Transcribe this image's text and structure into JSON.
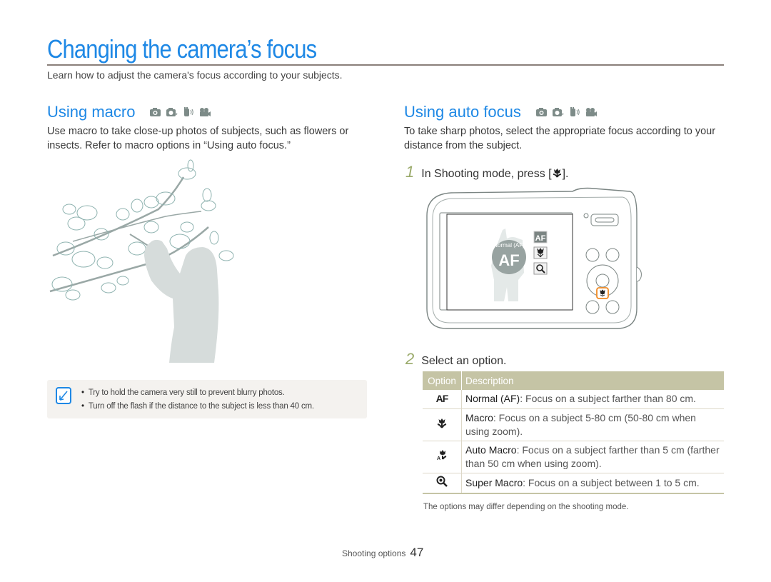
{
  "page": {
    "title": "Changing the camera’s focus",
    "intro": "Learn how to adjust the camera's focus according to your subjects."
  },
  "macro_section": {
    "title": "Using macro",
    "mode_icons": [
      "smart-auto-camera-icon",
      "program-camera-icon",
      "dual-is-icon",
      "movie-camera-icon"
    ],
    "body": "Use macro to take close-up photos of subjects, such as flowers or insects. Refer to macro options in “Using auto focus.”",
    "illustration": "woman-photographing-magnolia-branch",
    "tips": {
      "icon": "note-pencil-icon",
      "items": [
        "Try to hold the camera very still to prevent blurry photos.",
        "Turn off the flash if the distance to the subject is less than 40 cm."
      ]
    }
  },
  "autofocus_section": {
    "title": "Using auto focus",
    "mode_icons": [
      "smart-auto-camera-icon",
      "program-camera-icon",
      "dual-is-icon",
      "movie-camera-icon"
    ],
    "body": "To take sharp photos, select the appropriate focus according to your distance from the subject.",
    "steps": [
      {
        "number": "1",
        "text_before": "In Shooting mode, press [",
        "icon": "macro-flower-icon",
        "text_after": "]."
      },
      {
        "number": "2",
        "text": "Select an option."
      }
    ],
    "camera_screen": {
      "current_label": "Normal (AF)",
      "big_icon": "AF",
      "menu_icons": [
        "af-icon",
        "macro-flower-icon",
        "super-macro-magnifier-icon"
      ]
    },
    "table": {
      "headers": [
        "Option",
        "Description"
      ],
      "rows": [
        {
          "icon": "af-icon",
          "icon_text": "AF",
          "name": "Normal (AF)",
          "desc": ": Focus on a subject farther than 80 cm."
        },
        {
          "icon": "macro-flower-icon",
          "icon_text": "✿",
          "name": "Macro",
          "desc": ": Focus on a subject 5-80 cm (50-80 cm when using zoom)."
        },
        {
          "icon": "auto-macro-icon",
          "icon_text": "A✿",
          "name": "Auto Macro",
          "desc": ": Focus on a subject farther than 5 cm (farther than 50 cm when using zoom)."
        },
        {
          "icon": "super-macro-icon",
          "icon_text": "⊕",
          "name": "Super Macro",
          "desc": ": Focus on a subject between 1 to 5 cm."
        }
      ]
    },
    "note": "The options may differ depending on the shooting mode."
  },
  "footer": {
    "section": "Shooting options",
    "page_number": "47"
  },
  "colors": {
    "accent": "#1e88e5",
    "table_header": "#c5c4a5",
    "highlight_button": "#f08a24",
    "step_number": "#9aaa6a"
  }
}
